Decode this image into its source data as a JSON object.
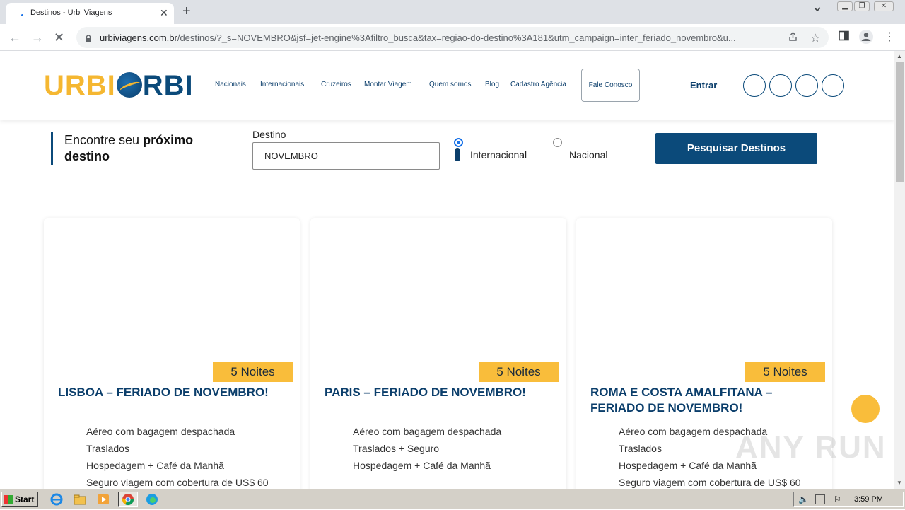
{
  "browser": {
    "tab_title": "Destinos - Urbi Viagens",
    "url_domain": "urbiviagens.com.br",
    "url_path": "/destinos/?_s=NOVEMBRO&jsf=jet-engine%3Afiltro_busca&tax=regiao-do-destino%3A181&utm_campaign=inter_feriado_novembro&u..."
  },
  "header": {
    "logo_left": "URBI",
    "logo_right": "RBI",
    "nav": [
      "Nacionais",
      "Internacionais",
      "Cruzeiros",
      "Montar Viagem",
      "Quem somos",
      "Blog",
      "Cadastro Agência"
    ],
    "contact_button": "Fale Conosco",
    "login": "Entrar"
  },
  "search": {
    "title_prefix": "Encontre seu ",
    "title_bold": "próximo destino",
    "destino_label": "Destino",
    "destino_value": "NOVEMBRO",
    "options": [
      {
        "label": "Internacional",
        "checked": true
      },
      {
        "label": "Nacional",
        "checked": false
      }
    ],
    "button": "Pesquisar Destinos"
  },
  "cards": [
    {
      "badge": "5 Noites",
      "title": "LISBOA – FERIADO DE NOVEMBRO!",
      "features": [
        "Aéreo com bagagem despachada",
        "Traslados",
        "Hospedagem + Café da Manhã",
        "Seguro viagem com cobertura de US$ 60"
      ]
    },
    {
      "badge": "5 Noites",
      "title": "PARIS – FERIADO DE NOVEMBRO!",
      "features": [
        "Aéreo com bagagem despachada",
        "Traslados + Seguro",
        "Hospedagem + Café da Manhã"
      ]
    },
    {
      "badge": "5 Noites",
      "title": "ROMA E COSTA AMALFITANA – FERIADO DE NOVEMBRO!",
      "features": [
        "Aéreo com bagagem despachada",
        "Traslados",
        "Hospedagem + Café da Manhã",
        "Seguro viagem com cobertura de US$ 60"
      ]
    }
  ],
  "watermark": "ANY RUN",
  "taskbar": {
    "start": "Start",
    "clock": "3:59 PM"
  },
  "colors": {
    "brand_blue": "#0b4a7a",
    "brand_yellow": "#f5b731",
    "badge_yellow": "#f9bd3b"
  }
}
